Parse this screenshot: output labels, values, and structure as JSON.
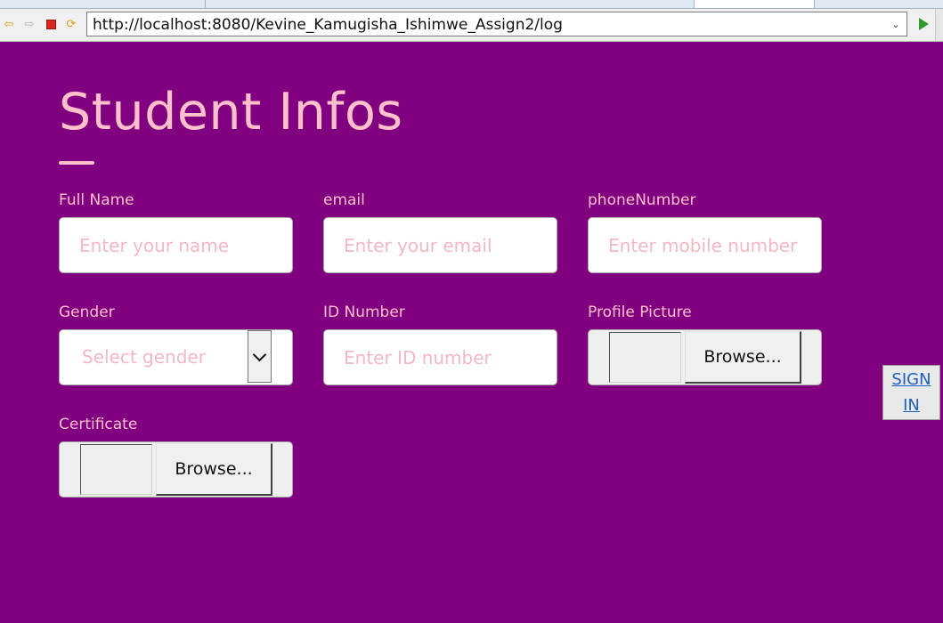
{
  "browser": {
    "url": "http://localhost:8080/Kevine_Kamugisha_Ishimwe_Assign2/log"
  },
  "form": {
    "title": "Student Infos",
    "fields": {
      "full_name": {
        "label": "Full Name",
        "placeholder": "Enter your name"
      },
      "email": {
        "label": "email",
        "placeholder": "Enter your email"
      },
      "phone": {
        "label": "phoneNumber",
        "placeholder": "Enter mobile number"
      },
      "gender": {
        "label": "Gender",
        "placeholder": "Select gender"
      },
      "id_number": {
        "label": "ID Number",
        "placeholder": "Enter ID number"
      },
      "profile_picture": {
        "label": "Profile Picture",
        "button": "Browse..."
      },
      "certificate": {
        "label": "Certificate",
        "button": "Browse..."
      }
    }
  },
  "signin_link": "SIGN IN",
  "colors": {
    "page_background": "#800080",
    "accent_pink": "#ffc0cb",
    "link_blue": "#1f5fbf"
  }
}
